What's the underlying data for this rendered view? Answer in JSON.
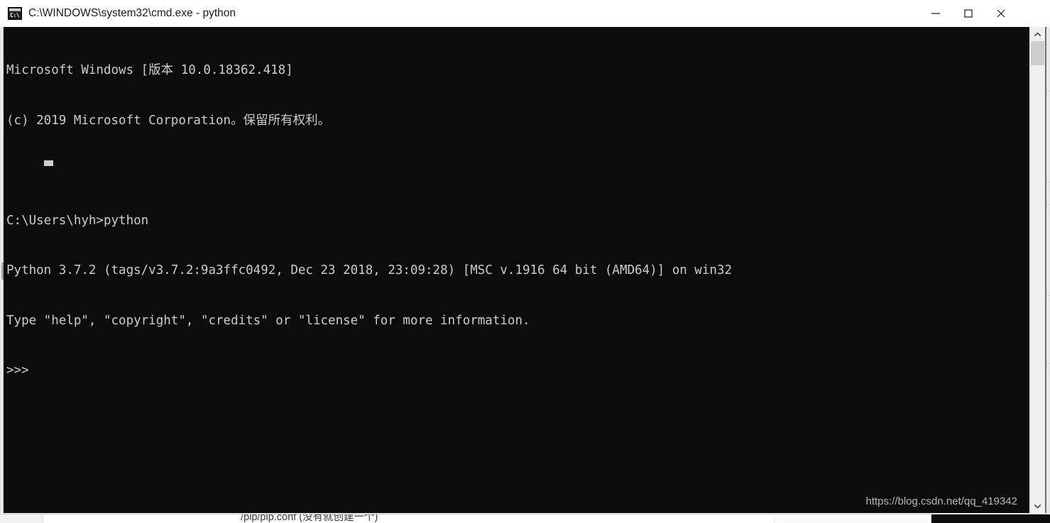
{
  "window": {
    "title": "C:\\WINDOWS\\system32\\cmd.exe - python",
    "icon_name": "cmd-icon",
    "icon_prompt_text": "C:\\",
    "controls": {
      "minimize_label": "—",
      "maximize_label": "☐",
      "close_label": "✕"
    },
    "title_bar_bg": "#ffffff",
    "title_text_color": "#1b1b1b"
  },
  "console": {
    "background": "#0c0c0c",
    "foreground": "#cccccc",
    "lines": [
      "Microsoft Windows [版本 10.0.18362.418]",
      "(c) 2019 Microsoft Corporation。保留所有权利。",
      "",
      "C:\\Users\\hyh>python",
      "Python 3.7.2 (tags/v3.7.2:9a3ffc0492, Dec 23 2018, 23:09:28) [MSC v.1916 64 bit (AMD64)] on win32",
      "Type \"help\", \"copyright\", \"credits\" or \"license\" for more information.",
      ">>>"
    ],
    "prompt": ">>>",
    "cursor": "block"
  },
  "scrollbar": {
    "up_arrow_name": "scroll-up-arrow",
    "down_arrow_name": "scroll-down-arrow",
    "track_color": "#f0f0f0",
    "thumb_color": "#cdcdcd"
  },
  "watermark": {
    "text": "https://blog.csdn.net/qq_419342",
    "color": "#b8b8b8"
  },
  "background_page": {
    "partial_text": "/pip/pip.conf (没有就创建一个)"
  }
}
